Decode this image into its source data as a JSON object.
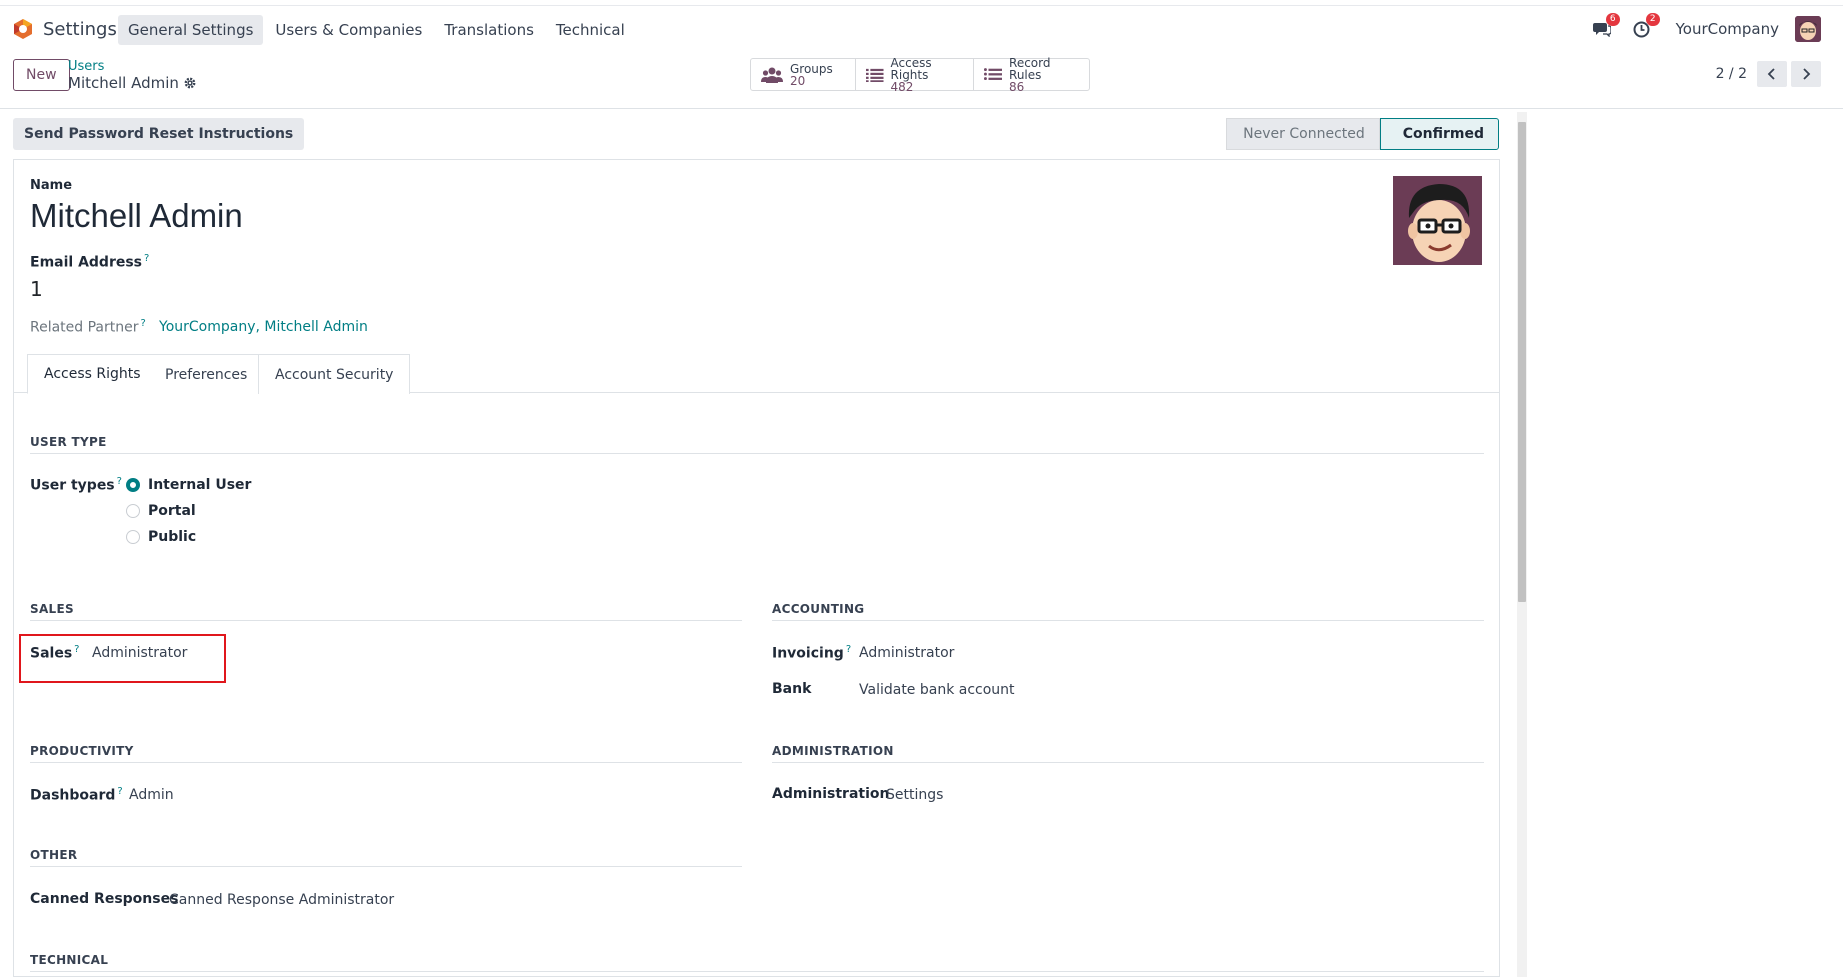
{
  "topbar": {
    "app_name": "Settings",
    "menu": [
      "General Settings",
      "Users & Companies",
      "Translations",
      "Technical"
    ],
    "messages_badge": "6",
    "activities_badge": "2",
    "company": "YourCompany"
  },
  "control": {
    "new_label": "New",
    "breadcrumb_parent": "Users",
    "breadcrumb_current": "Mitchell Admin",
    "smart_buttons": [
      {
        "label": "Groups",
        "value": "20",
        "icon": "users-icon"
      },
      {
        "label": "Access Rights",
        "value": "482",
        "icon": "list-icon"
      },
      {
        "label": "Record Rules",
        "value": "86",
        "icon": "list-icon"
      }
    ],
    "pager": "2 / 2"
  },
  "status": {
    "reset_label": "Send Password Reset Instructions",
    "stages": [
      "Never Connected",
      "Confirmed"
    ],
    "active_stage": "Confirmed"
  },
  "form": {
    "name_label": "Name",
    "name_value": "Mitchell Admin",
    "email_label": "Email Address",
    "email_value": "1",
    "partner_label": "Related Partner",
    "partner_value": "YourCompany, Mitchell Admin",
    "help_mark": "?",
    "tabs": [
      "Access Rights",
      "Preferences",
      "Account Security"
    ],
    "user_type": {
      "section": "USER TYPE",
      "label": "User types",
      "options": [
        "Internal User",
        "Portal",
        "Public"
      ],
      "selected": "Internal User"
    },
    "sales": {
      "section": "SALES",
      "label": "Sales",
      "value": "Administrator"
    },
    "accounting": {
      "section": "ACCOUNTING",
      "invoicing_label": "Invoicing",
      "invoicing_value": "Administrator",
      "bank_label": "Bank",
      "bank_value": "Validate bank account"
    },
    "productivity": {
      "section": "PRODUCTIVITY",
      "label": "Dashboard",
      "value": "Admin"
    },
    "administration": {
      "section": "ADMINISTRATION",
      "label": "Administration",
      "value": "Settings"
    },
    "other": {
      "section": "OTHER",
      "label": "Canned Responses",
      "value": "Canned Response Administrator"
    },
    "technical": {
      "section": "TECHNICAL"
    }
  },
  "colors": {
    "brand": "#714b67",
    "accent": "#017e84",
    "highlight": "#e0161c"
  }
}
